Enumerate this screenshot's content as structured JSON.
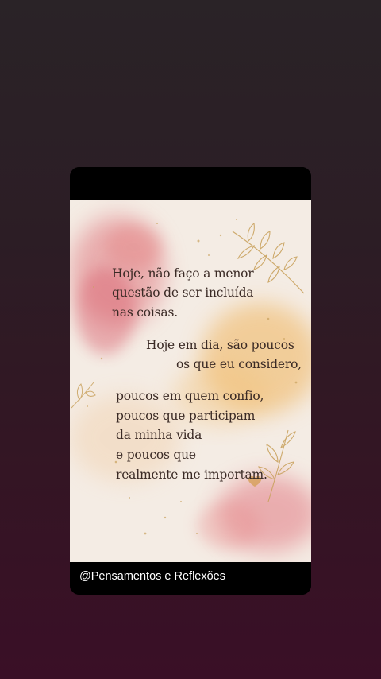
{
  "post": {
    "quote_lines": [
      "Hoje, não faço a menor",
      "questão de ser incluída",
      "nas coisas.",
      "Hoje em dia, são poucos",
      "os que eu considero,",
      "poucos em quem confio,",
      "poucos que participam",
      "da minha vida",
      "e poucos que",
      "realmente me importam."
    ],
    "decor_icons": [
      "leaf-branch-icon",
      "heart-icon"
    ],
    "colors": {
      "paper": "#f4ece4",
      "watercolor_pink": "#e07a82",
      "watercolor_orange": "#f0b45c",
      "gold": "#c9a25e",
      "text": "#3a2a25"
    }
  },
  "caption": {
    "handle": "@Pensamentos e Reflexões"
  }
}
